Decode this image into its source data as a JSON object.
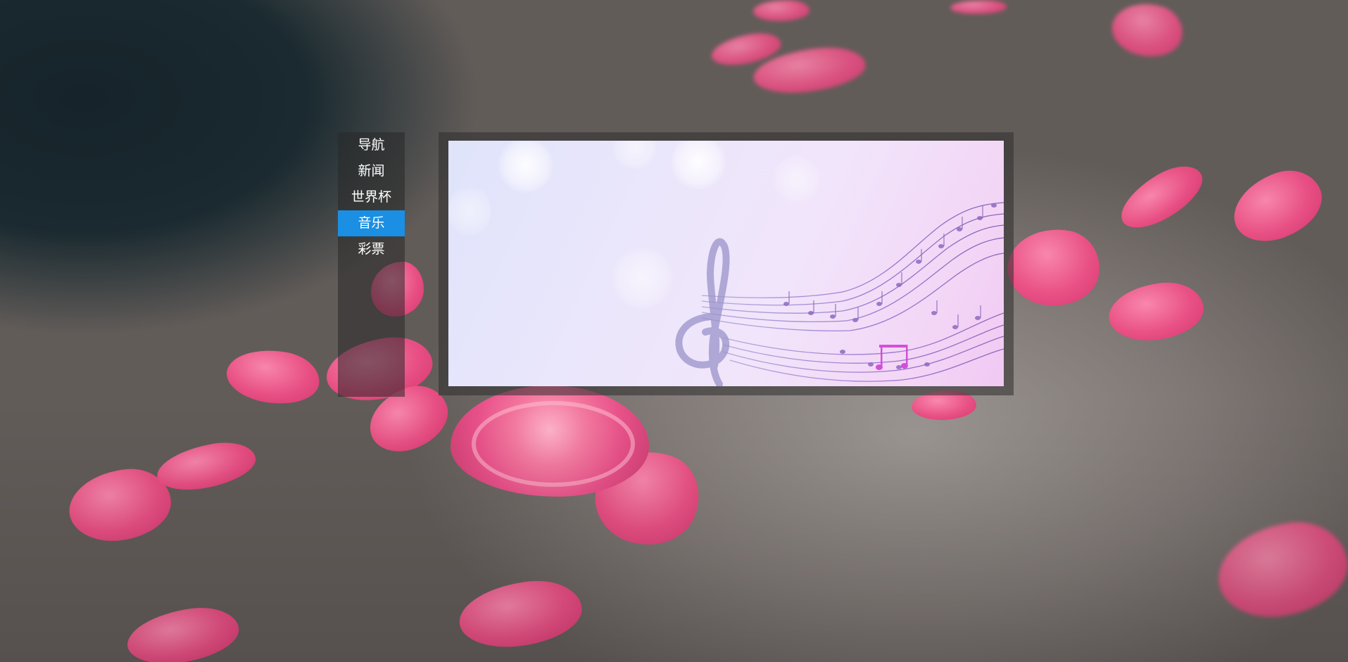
{
  "nav": {
    "items": [
      {
        "label": "导航",
        "active": false
      },
      {
        "label": "新闻",
        "active": false
      },
      {
        "label": "世界杯",
        "active": false
      },
      {
        "label": "音乐",
        "active": true
      },
      {
        "label": "彩票",
        "active": false
      }
    ],
    "active_color": "#1a8fe3"
  },
  "content": {
    "image": "music-notes-banner"
  }
}
